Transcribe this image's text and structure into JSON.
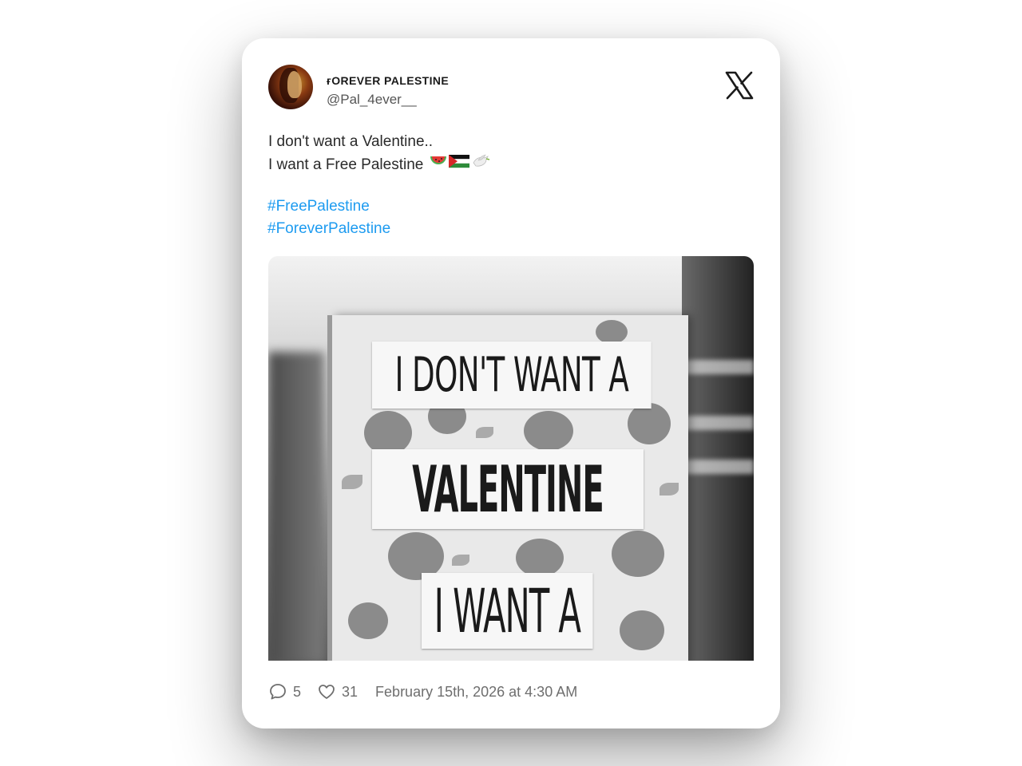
{
  "post": {
    "author": {
      "display_name": "ғOREVER PALESTINE",
      "handle": "@Pal_4ever__",
      "avatar_icon": "avatar-portrait"
    },
    "platform_icon": "x-logo-icon",
    "text_lines": [
      "I don't want a Valentine..",
      "I want a Free Palestine"
    ],
    "emojis": [
      "watermelon",
      "palestine-flag",
      "dove"
    ],
    "hashtags": [
      "#FreePalestine",
      "#ForeverPalestine"
    ],
    "image": {
      "description_icon": "protest-sign-photo",
      "sign_text": [
        "I DON'T WANT A",
        "VALENTINE",
        "I WANT A"
      ]
    },
    "stats": {
      "replies": "5",
      "likes": "31"
    },
    "timestamp": "February 15th, 2026 at 4:30 AM"
  },
  "colors": {
    "hashtag": "#1d9bf0",
    "text": "#2a2a2a",
    "muted": "#6e6e6e"
  }
}
